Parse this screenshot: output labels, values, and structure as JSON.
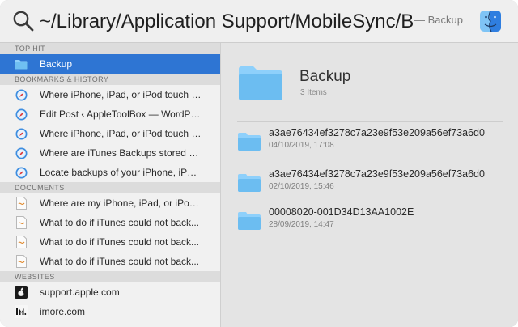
{
  "search": {
    "query": "~/Library/Application Support/MobileSync/Ba",
    "kind_hint": "— Backup",
    "search_icon": "magnifier-icon",
    "app_icon": "finder-icon"
  },
  "sidebar": {
    "sections": [
      {
        "header": "TOP HIT",
        "items": [
          {
            "label": "Backup",
            "icon": "folder-icon",
            "selected": true
          }
        ]
      },
      {
        "header": "BOOKMARKS & HISTORY",
        "items": [
          {
            "label": "Where iPhone, iPad, or iPod touch b...",
            "icon": "safari-icon"
          },
          {
            "label": "Edit Post ‹ AppleToolBox — WordPre...",
            "icon": "safari-icon"
          },
          {
            "label": "Where iPhone, iPad, or iPod touch b...",
            "icon": "safari-icon"
          },
          {
            "label": "Where are iTunes Backups stored on...",
            "icon": "safari-icon"
          },
          {
            "label": "Locate backups of your iPhone, iPad...",
            "icon": "safari-icon"
          }
        ]
      },
      {
        "header": "DOCUMENTS",
        "items": [
          {
            "label": "Where are my iPhone, iPad, or iPod t...",
            "icon": "document-icon"
          },
          {
            "label": "What to do if iTunes could not back...",
            "icon": "document-icon"
          },
          {
            "label": "What to do if iTunes could not back...",
            "icon": "document-icon"
          },
          {
            "label": "What to do if iTunes could not back...",
            "icon": "document-icon"
          }
        ]
      },
      {
        "header": "WEBSITES",
        "items": [
          {
            "label": "support.apple.com",
            "icon": "apple-logo-icon"
          },
          {
            "label": "imore.com",
            "icon": "imore-logo-icon"
          }
        ]
      }
    ]
  },
  "preview": {
    "title": "Backup",
    "subtitle": "3 Items",
    "files": [
      {
        "name": "a3ae76434ef3278c7a23e9f53e209a56ef73a6d0",
        "date": "04/10/2019, 17:08"
      },
      {
        "name": "a3ae76434ef3278c7a23e9f53e209a56ef73a6d0",
        "date": "02/10/2019, 15:46"
      },
      {
        "name": "00008020-001D34D13AA1002E",
        "date": "28/09/2019, 14:47"
      }
    ]
  },
  "colors": {
    "selection": "#2e75d3",
    "folder": "#69b9ef",
    "safari": "#3d8de0"
  }
}
